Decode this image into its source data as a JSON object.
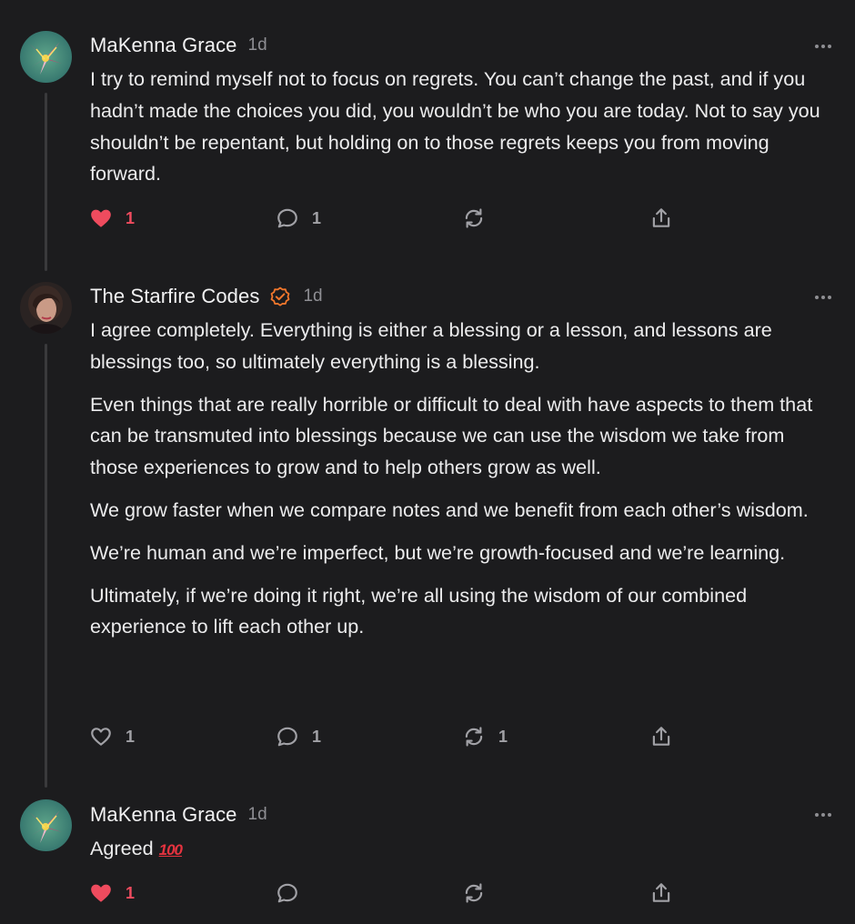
{
  "colors": {
    "background": "#1c1c1e",
    "text": "#ececed",
    "muted": "#8e8e93",
    "like_active": "#ef4b5e",
    "verified": "#f2772c"
  },
  "posts": [
    {
      "author": "MaKenna Grace",
      "time": "1d",
      "verified": false,
      "paragraphs": [
        "I try to remind myself not to focus on regrets. You can’t change the past, and if you hadn’t made the choices you did, you wouldn’t be who you are today. Not to say you shouldn’t be repentant, but holding on to those regrets keeps you from moving forward."
      ],
      "likes": "1",
      "liked": true,
      "comments": "1",
      "restacks": "",
      "icons": [
        "heart-filled-icon",
        "comment-icon",
        "restack-icon",
        "share-icon"
      ]
    },
    {
      "author": "The Starfire Codes",
      "time": "1d",
      "verified": true,
      "paragraphs": [
        "I agree completely. Everything is either a blessing or a lesson, and lessons are blessings too, so ultimately everything is a blessing.",
        "Even things that are really horrible or difficult to deal with have aspects to them that can be transmuted into blessings because we can use the wisdom we take from those experiences to grow and to help others grow as well.",
        "We grow faster when we compare notes and we benefit from each other’s wisdom.",
        "We’re human and we’re imperfect, but we’re growth-focused and we’re learning.",
        "Ultimately, if we’re doing it right, we’re all using the wisdom of our combined experience to lift each other up."
      ],
      "likes": "1",
      "liked": false,
      "comments": "1",
      "restacks": "1",
      "icons": [
        "heart-outline-icon",
        "comment-icon",
        "restack-icon",
        "share-icon"
      ]
    },
    {
      "author": "MaKenna Grace",
      "time": "1d",
      "verified": false,
      "text": "Agreed",
      "emoji": "100",
      "likes": "1",
      "liked": true,
      "comments": "",
      "restacks": "",
      "icons": [
        "heart-filled-icon",
        "comment-icon",
        "restack-icon",
        "share-icon",
        "hundred-points-emoji"
      ]
    }
  ]
}
